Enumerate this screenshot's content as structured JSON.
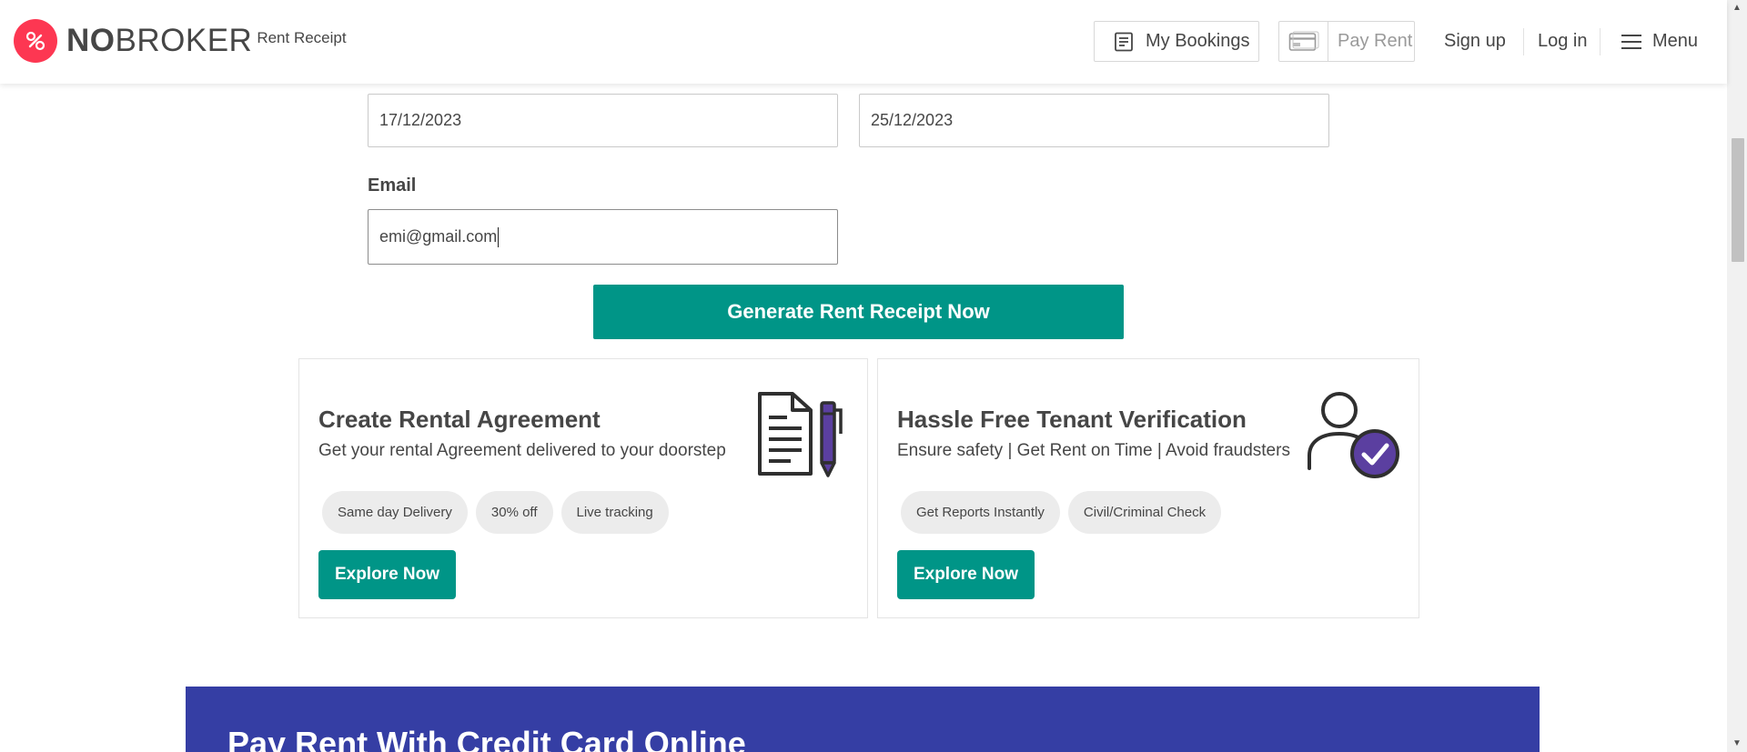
{
  "header": {
    "brand_bold": "NO",
    "brand_rest": "BROKER",
    "brand_sub": "Rent Receipt",
    "my_bookings": "My Bookings",
    "pay_rent": "Pay Rent",
    "sign_up": "Sign up",
    "log_in": "Log in",
    "menu": "Menu"
  },
  "form": {
    "start_date": "17/12/2023",
    "end_date": "25/12/2023",
    "email_label": "Email",
    "email_value": "emi@gmail.com",
    "generate_button": "Generate Rent Receipt Now"
  },
  "cards": {
    "rental": {
      "title": "Create Rental Agreement",
      "subtitle": "Get your rental Agreement delivered to your doorstep",
      "chips": [
        "Same day Delivery",
        "30% off",
        "Live tracking"
      ],
      "button": "Explore Now",
      "icon": "document-pen-icon"
    },
    "tenant": {
      "title": "Hassle Free Tenant Verification",
      "subtitle": "Ensure safety | Get Rent on Time | Avoid fraudsters",
      "chips": [
        "Get Reports Instantly",
        "Civil/Criminal Check"
      ],
      "button": "Explore Now",
      "icon": "user-verified-icon"
    }
  },
  "banner": {
    "title": "Pay Rent With Credit Card Online"
  },
  "colors": {
    "brand_red": "#fd3752",
    "primary_teal": "#009587",
    "banner_blue": "#353ea4",
    "icon_purple": "#5b3fa0",
    "text_dark": "#464646",
    "chip_bg": "#ececec"
  }
}
